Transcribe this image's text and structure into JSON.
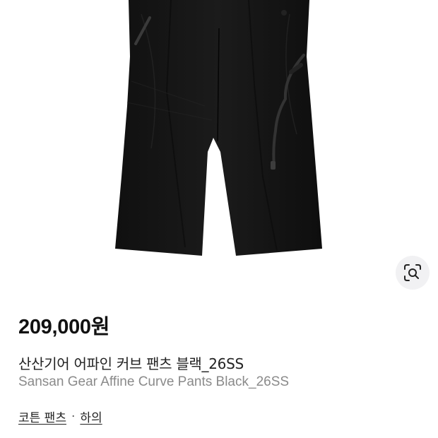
{
  "product": {
    "price": "209,000원",
    "title_ko": "산산기어 어파인 커브 팬츠 블랙_26SS",
    "title_en": "Sansan Gear Affine Curve Pants Black_26SS"
  },
  "image_search_icon": "lens-search-icon",
  "breadcrumb": {
    "category": "코튼 팬츠",
    "separator": "·",
    "parent": "하의"
  },
  "colors": {
    "product_black": "#141414",
    "lens_button_bg": "#f1f1f3",
    "secondary_text": "#8a8a8a"
  }
}
